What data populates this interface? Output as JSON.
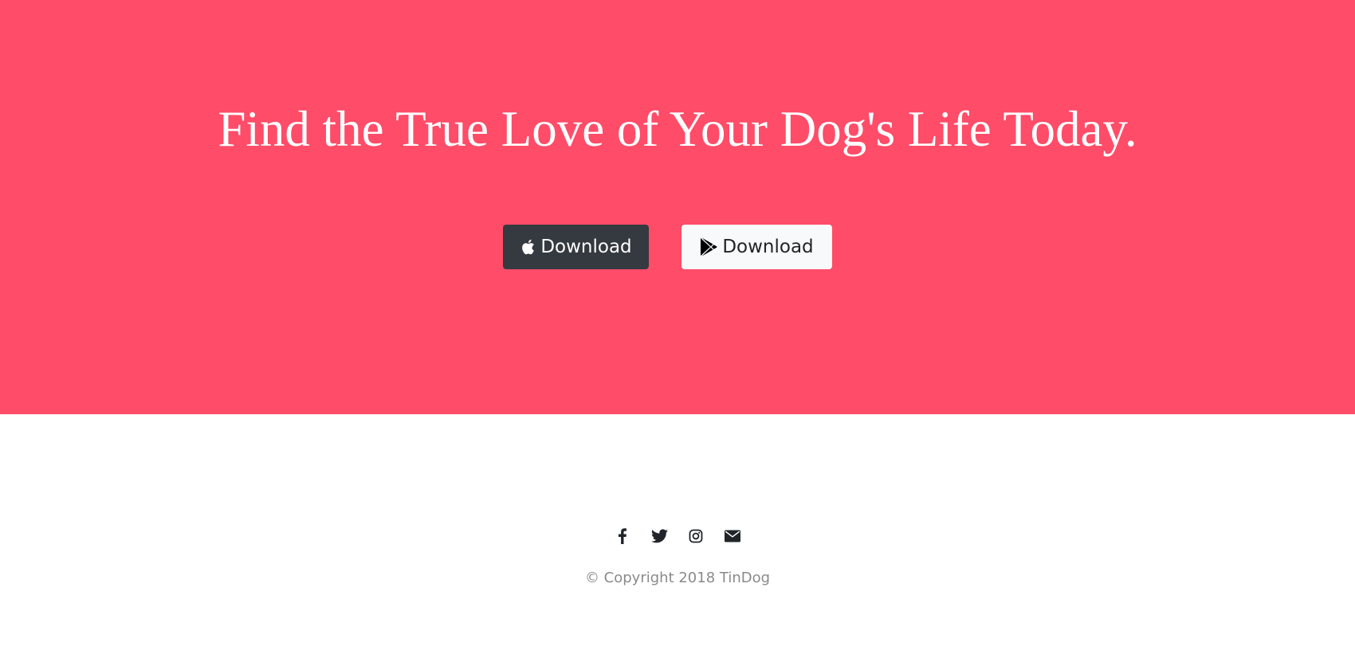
{
  "hero": {
    "title": "Find the True Love of Your Dog's Life Today.",
    "background_color": "#ff4c68",
    "buttons": [
      {
        "label": "Download",
        "icon": "apple-icon",
        "style": "dark"
      },
      {
        "label": "Download",
        "icon": "google-play-icon",
        "style": "light"
      }
    ]
  },
  "footer": {
    "social_icons": [
      "facebook-icon",
      "twitter-icon",
      "instagram-icon",
      "envelope-icon"
    ],
    "copyright": "© Copyright 2018 TinDog"
  }
}
